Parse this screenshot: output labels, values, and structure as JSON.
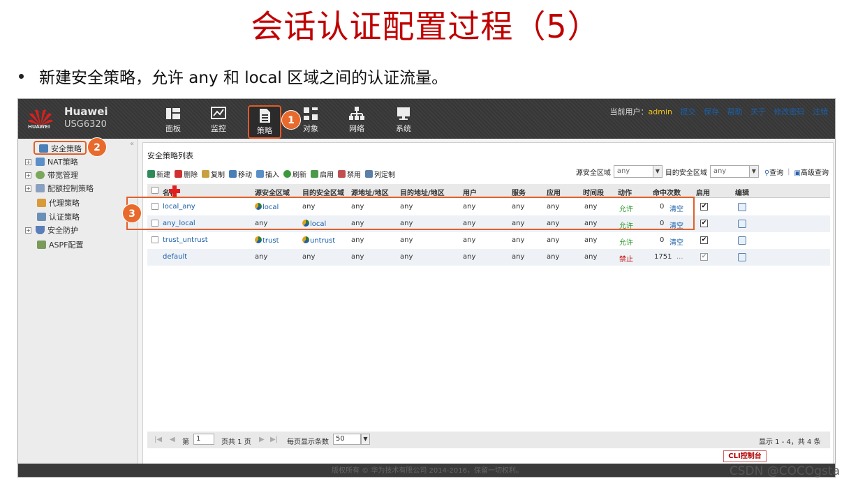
{
  "slide": {
    "title": "会话认证配置过程（5）",
    "bullet": "新建安全策略，允许 any 和 local 区域之间的认证流量。",
    "watermark": "CSDN @COCOgsta"
  },
  "header": {
    "brand": "Huawei",
    "model": "USG6320",
    "logo_text": "HUAWEI",
    "nav": [
      {
        "label": "面板",
        "icon": "dashboard-icon"
      },
      {
        "label": "监控",
        "icon": "monitor-icon"
      },
      {
        "label": "策略",
        "icon": "policy-icon"
      },
      {
        "label": "对象",
        "icon": "object-icon"
      },
      {
        "label": "网络",
        "icon": "network-icon"
      },
      {
        "label": "系统",
        "icon": "system-icon"
      }
    ],
    "current_user_label": "当前用户：",
    "user": "admin",
    "links": [
      "提交",
      "保存",
      "帮助",
      "关于",
      "修改密码",
      "注销"
    ]
  },
  "callouts": [
    "1",
    "2",
    "3"
  ],
  "sidebar": {
    "items": [
      {
        "label": "安全策略"
      },
      {
        "label": "NAT策略"
      },
      {
        "label": "带宽管理"
      },
      {
        "label": "配额控制策略"
      },
      {
        "label": "代理策略"
      },
      {
        "label": "认证策略"
      },
      {
        "label": "安全防护"
      },
      {
        "label": "ASPF配置"
      }
    ]
  },
  "main": {
    "title": "安全策略列表",
    "toolbar": [
      "新建",
      "删除",
      "复制",
      "移动",
      "插入",
      "刷新",
      "启用",
      "禁用",
      "列定制"
    ],
    "filters": {
      "src_label": "源安全区域",
      "src_value": "any",
      "dst_label": "目的安全区域",
      "dst_value": "any",
      "query": "查询",
      "advanced": "高级查询"
    },
    "columns": [
      "名称",
      "源安全区域",
      "目的安全区域",
      "源地址/地区",
      "目的地址/地区",
      "用户",
      "服务",
      "应用",
      "时间段",
      "动作",
      "命中次数",
      "启用",
      "编辑"
    ],
    "rows": [
      {
        "name": "local_any",
        "src_zone": "local",
        "dst_zone": "any",
        "src_addr": "any",
        "dst_addr": "any",
        "user": "any",
        "service": "any",
        "app": "any",
        "time": "any",
        "action": "允许",
        "hits": "0",
        "clear": "清空",
        "enabled": "✔"
      },
      {
        "name": "any_local",
        "src_zone": "any",
        "dst_zone": "local",
        "src_addr": "any",
        "dst_addr": "any",
        "user": "any",
        "service": "any",
        "app": "any",
        "time": "any",
        "action": "允许",
        "hits": "0",
        "clear": "清空",
        "enabled": "✔"
      },
      {
        "name": "trust_untrust",
        "src_zone": "trust",
        "dst_zone": "untrust",
        "src_addr": "any",
        "dst_addr": "any",
        "user": "any",
        "service": "any",
        "app": "any",
        "time": "any",
        "action": "允许",
        "hits": "0",
        "clear": "清空",
        "enabled": "✔"
      },
      {
        "name": "default",
        "src_zone": "any",
        "dst_zone": "any",
        "src_addr": "any",
        "dst_addr": "any",
        "user": "any",
        "service": "any",
        "app": "any",
        "time": "any",
        "action": "禁止",
        "hits": "1751",
        "clear": "...",
        "enabled": "✔"
      }
    ],
    "pager": {
      "page_label": "第",
      "page_value": "1",
      "of_label": "页共 1 页",
      "per_page_label": "每页显示条数",
      "per_page_value": "50",
      "summary": "显示 1 - 4，共 4 条"
    }
  },
  "cli_button": "CLI控制台",
  "footer": "版权所有 © 华为技术有限公司 2014-2016，保留一切权利。",
  "colors": {
    "accent": "#e86a2c",
    "title_red": "#c00000",
    "allow": "#2a9a2a",
    "deny": "#c00000",
    "link": "#1a5fa8"
  }
}
